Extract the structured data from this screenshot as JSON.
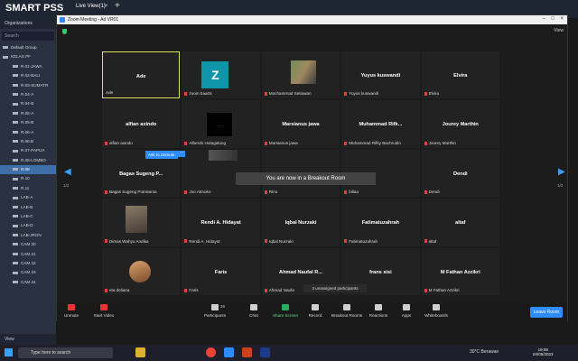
{
  "smartpss": {
    "title": "SMART PSS",
    "tab": "Live View(1)",
    "tab_close": "×",
    "plus": "+",
    "sidebar": {
      "heading": "Organizations",
      "search": "Search",
      "view": "View",
      "items": [
        "Default Group",
        "KELAS PF",
        "R.01-JAWA",
        "R.02-BALI",
        "R.03-SUMATR",
        "R.04-A",
        "R.04-B",
        "R.05-A",
        "R.05-B",
        "R.06-A",
        "R.06.B",
        "R.07-PAPUA",
        "R.08-LOMBO",
        "R.09",
        "R.10",
        "R.11",
        "LAB-A",
        "LAB-B",
        "LAB-C",
        "LAB-D",
        "LAB-JRGN",
        "CAM 20",
        "CAM 21",
        "CAM 22",
        "CAM 23",
        "CAM 24"
      ],
      "selected_index": 13
    }
  },
  "zoom": {
    "title": "Zoom Meeting - Ad VR01",
    "view": "View",
    "breakout_banner": "You are now in a Breakout Room",
    "unmute_tip": "Ask to Unmute",
    "more": "···",
    "unassigned": "3 unassigned participants",
    "page_left": "1/2",
    "page_right": "1/2",
    "tiles": [
      {
        "name": "Ade",
        "label": "Ade",
        "kind": "active"
      },
      {
        "name": "",
        "label": "zoom baa04",
        "kind": "zavatar",
        "letter": "Z"
      },
      {
        "name": "",
        "label": "Mochammad Setiawan",
        "kind": "photo2"
      },
      {
        "name": "Yuyus kuswandi",
        "label": "Yuyus kuswandi"
      },
      {
        "name": "Elvira",
        "label": "Elvira"
      },
      {
        "name": "alfian axindo",
        "label": "alfian axindo"
      },
      {
        "name": "",
        "label": "Alberdo Hutagalung",
        "kind": "dark",
        "dots": "……"
      },
      {
        "name": "Marsianus jawa",
        "label": "Marsianus jawa"
      },
      {
        "name": "Muhammad Rifk...",
        "label": "Muhammad Rifky Bachrudin"
      },
      {
        "name": "Jourey Marthin",
        "label": "Jourey Marthin"
      },
      {
        "name": "Bagas Sugeng P...",
        "label": "Bagas Sugeng Putratama"
      },
      {
        "name": "",
        "label": "Joo Atmoko",
        "kind": "topdark"
      },
      {
        "name": "",
        "label": "Rino"
      },
      {
        "name": "",
        "label": "billaa"
      },
      {
        "name": "Dendi",
        "label": "Dendi"
      },
      {
        "name": "",
        "label": "Dimas Wahyu Andika",
        "kind": "photo"
      },
      {
        "name": "Rendi A. Hidayat",
        "label": "Rendi A. Hidayat"
      },
      {
        "name": "Iqbal Nurzaki",
        "label": "Iqbal Nurzaki"
      },
      {
        "name": "Fatimatuzahrah",
        "label": "Fatimatuzahrah"
      },
      {
        "name": "altaf",
        "label": "altaf"
      },
      {
        "name": "",
        "label": "eta deliana",
        "kind": "photo3"
      },
      {
        "name": "Faris",
        "label": "Faris"
      },
      {
        "name": "Ahmad Naufal R...",
        "label": "Ahmad Naufa"
      },
      {
        "name": "frans sisi",
        "label": "frans sisi"
      },
      {
        "name": "M Fathan Azzikri",
        "label": "M Fathan Azzikri"
      }
    ],
    "toolbar": {
      "unmute": "Unmute",
      "video": "Start Video",
      "participants": "Participants",
      "participants_count": "26",
      "chat": "Chat",
      "share": "Share Screen",
      "record": "Record",
      "breakout": "Breakout Rooms",
      "reactions": "Reactions",
      "apps": "Apps",
      "whiteboards": "Whiteboards",
      "leave": "Leave Room"
    }
  },
  "taskbar": {
    "search": "Type here to search",
    "weather": "30°C  Berawan",
    "time": "19:08",
    "date": "04/05/2023"
  }
}
